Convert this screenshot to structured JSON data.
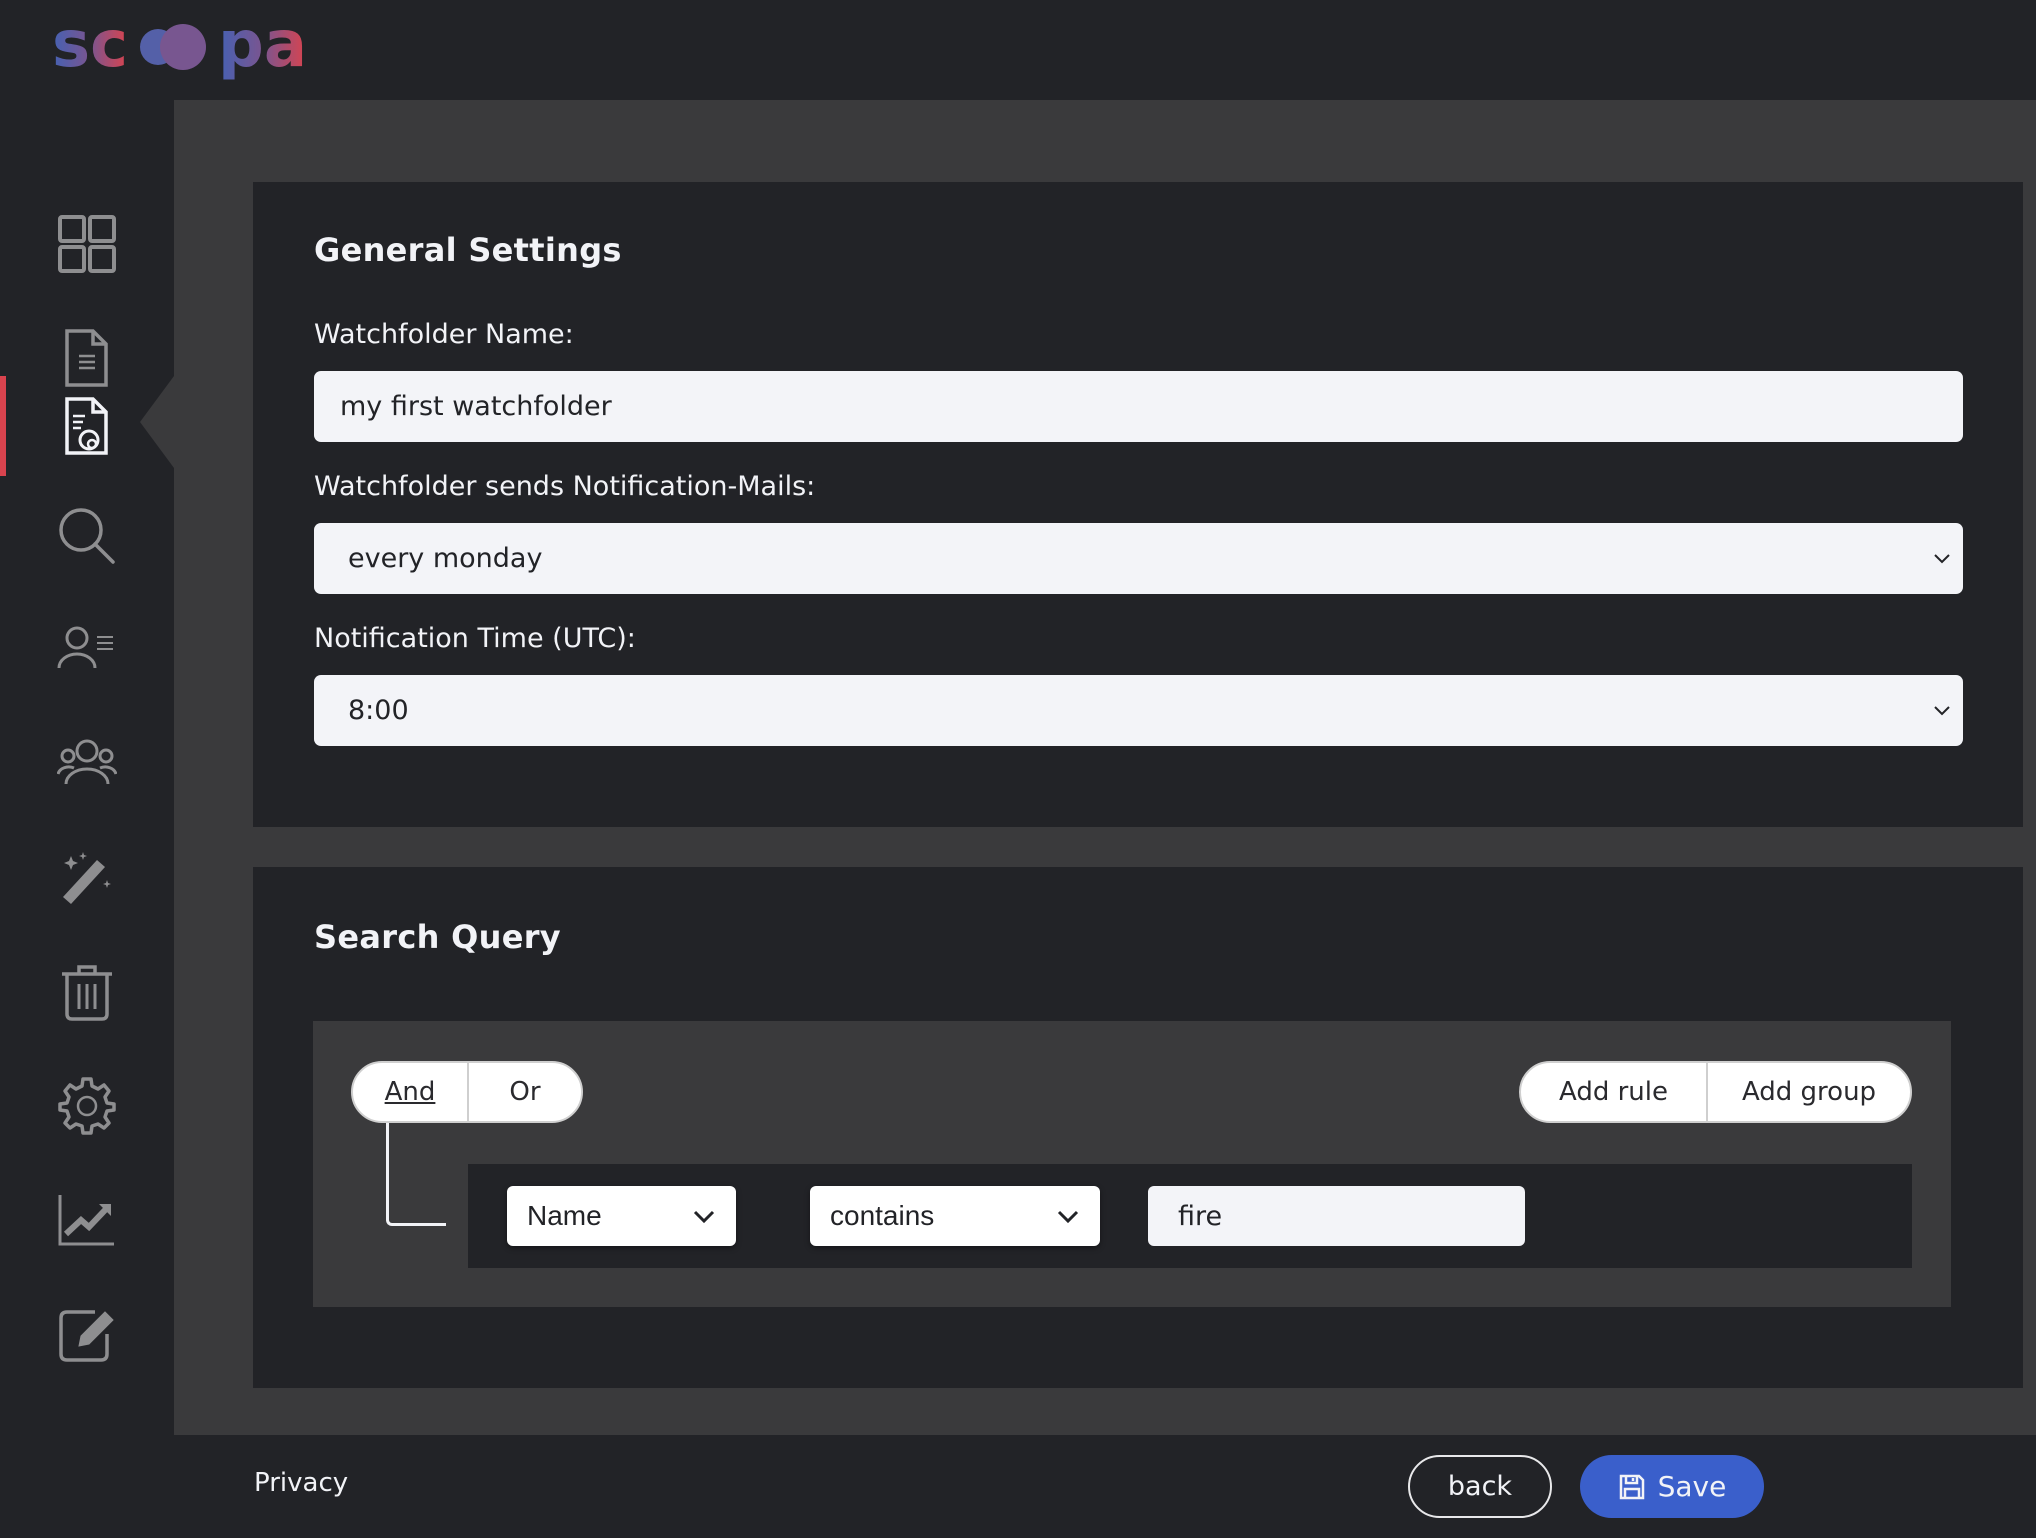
{
  "app": {
    "logo_text": "scoopa",
    "logo_colors": {
      "start": "#4561b3",
      "mid": "#7a5590",
      "end": "#d9434e"
    }
  },
  "sidebar": {
    "active_index": 2,
    "accent": "#d9434e",
    "items": [
      {
        "icon": "dashboard-grid-icon"
      },
      {
        "icon": "document-icon"
      },
      {
        "icon": "document-settings-icon"
      },
      {
        "icon": "search-icon"
      },
      {
        "icon": "user-list-icon"
      },
      {
        "icon": "users-group-icon"
      },
      {
        "icon": "magic-wand-icon"
      },
      {
        "icon": "trash-icon"
      },
      {
        "icon": "gear-icon"
      },
      {
        "icon": "chart-trend-icon"
      },
      {
        "icon": "edit-icon"
      }
    ]
  },
  "general_settings": {
    "title": "General Settings",
    "name_label": "Watchfolder Name:",
    "name_value": "my first watchfolder",
    "mails_label": "Watchfolder sends Notification-Mails:",
    "mails_value": "every monday",
    "time_label": "Notification Time (UTC):",
    "time_value": "8:00"
  },
  "search_query": {
    "title": "Search Query",
    "combinators": [
      "And",
      "Or"
    ],
    "selected_combinator": "And",
    "add_rule_label": "Add rule",
    "add_group_label": "Add group",
    "rules": [
      {
        "field": "Name",
        "operator": "contains",
        "value": "fire"
      }
    ]
  },
  "footer": {
    "privacy_label": "Privacy",
    "back_label": "back",
    "save_label": "Save",
    "save_color": "#3a5fcb"
  }
}
